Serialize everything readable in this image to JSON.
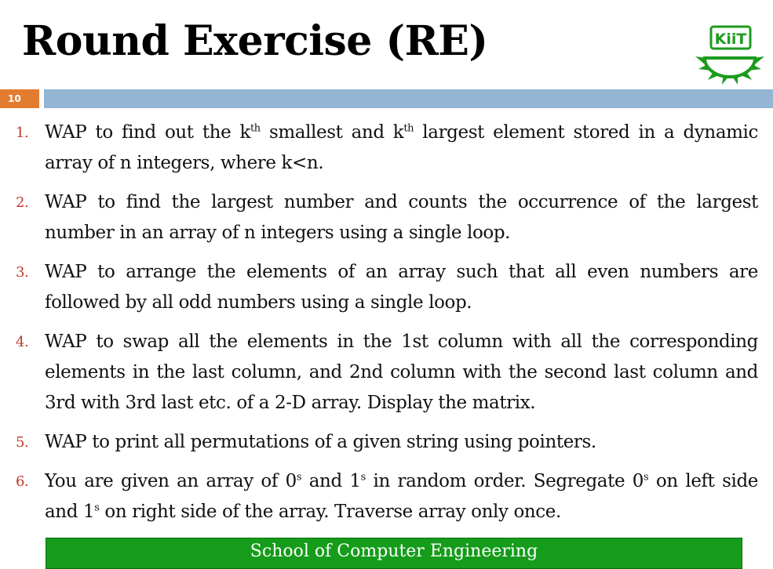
{
  "slide": {
    "title": "Round Exercise (RE)",
    "number": "10",
    "footer": "School of Computer Engineering",
    "logo_text": "KiiT",
    "colors": {
      "number_badge": "#e37c2f",
      "header_bar": "#94b6d2",
      "list_numbers": "#c0392b",
      "footer_bg": "#159c1a",
      "logo_green": "#1e9b1e"
    }
  },
  "exercises": [
    {
      "num": "1.",
      "parts": [
        "WAP to find out the k",
        "th",
        " smallest and k",
        "th",
        " largest element stored in a dynamic array of n integers, where k<n."
      ]
    },
    {
      "num": "2.",
      "text": "WAP to find the largest number and counts the occurrence of the largest number in an array of n integers using a single loop."
    },
    {
      "num": "3.",
      "text": "WAP to arrange the elements of an array such that all even numbers are followed by all odd numbers using a single loop."
    },
    {
      "num": "4.",
      "text": "WAP to swap all the elements in the 1st column with all the corresponding elements in the last column, and 2nd column with the second last column and 3rd with 3rd last etc. of a 2-D array.  Display the matrix."
    },
    {
      "num": "5.",
      "text": "WAP to print all permutations of a given string using pointers."
    },
    {
      "num": "6.",
      "parts": [
        "You are given an array of 0",
        "s",
        " and 1",
        "s",
        " in random order. Segregate 0",
        "s",
        " on left side and 1",
        "s",
        " on right side of the array. Traverse array only once."
      ]
    }
  ]
}
